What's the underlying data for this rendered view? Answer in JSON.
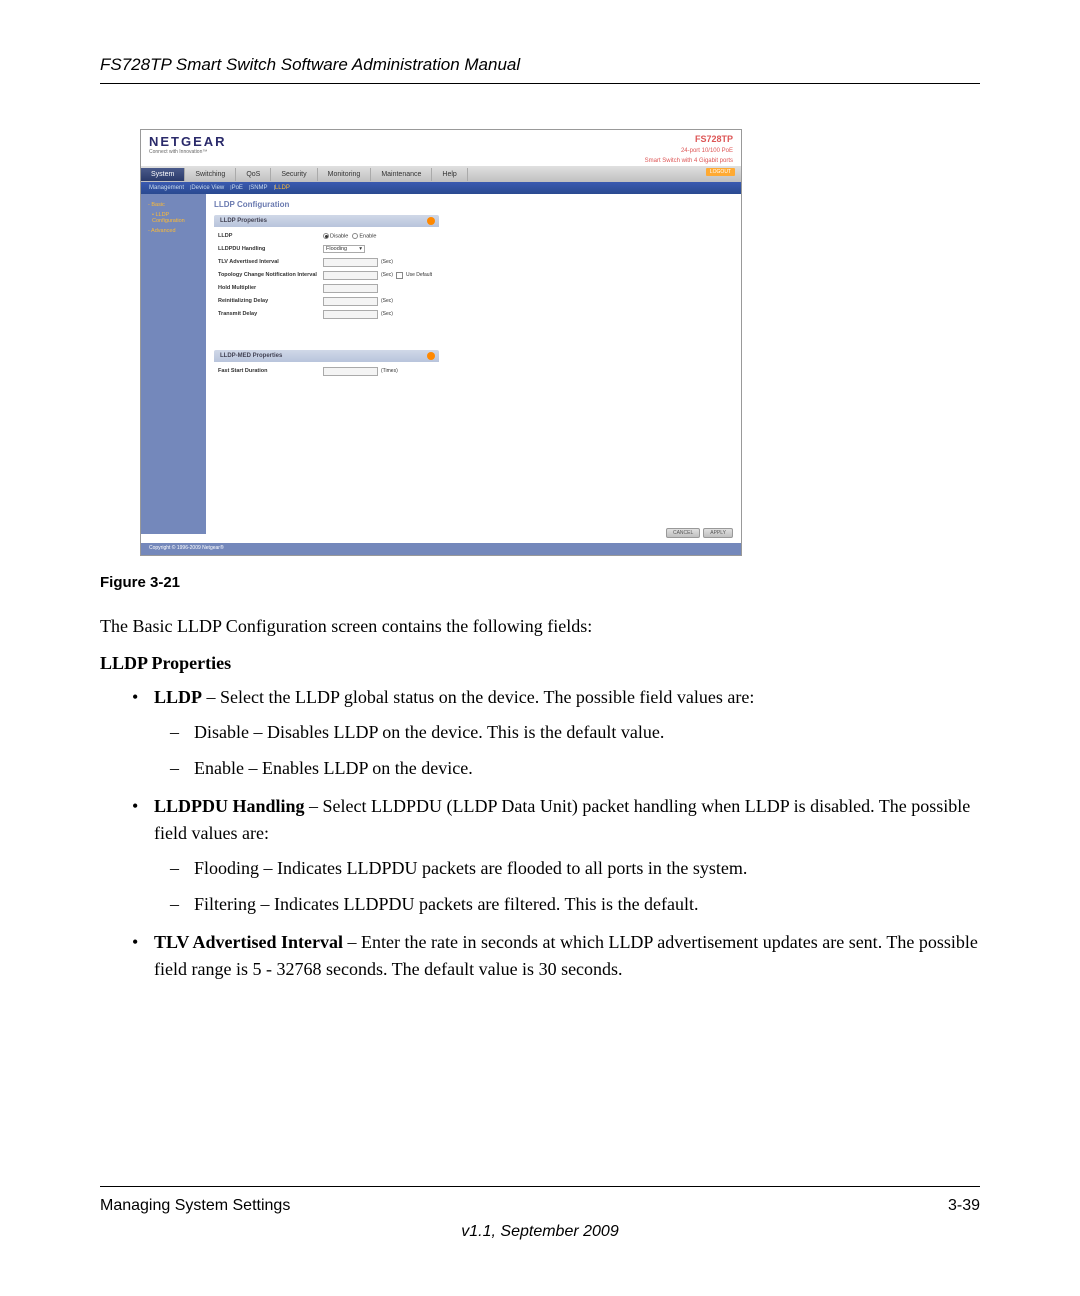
{
  "header": {
    "title": "FS728TP Smart Switch Software Administration Manual"
  },
  "screenshot": {
    "logo": "NETGEAR",
    "tagline": "Connect with Innovation™",
    "model": "FS728TP",
    "model_sub1": "24-port 10/100 PoE",
    "model_sub2": "Smart Switch with 4 Gigabit ports",
    "logout": "LOGOUT",
    "tabs": {
      "system": "System",
      "switching": "Switching",
      "qos": "QoS",
      "security": "Security",
      "monitoring": "Monitoring",
      "maintenance": "Maintenance",
      "help": "Help"
    },
    "subtabs": {
      "management": "Management",
      "device_view": "Device View",
      "poe": "PoE",
      "snmp": "SNMP",
      "lldp": "LLDP"
    },
    "sidebar": {
      "basic": "- Basic",
      "lldp_config": "• LLDP Configuration",
      "advanced": "- Advanced"
    },
    "page_title": "LLDP Configuration",
    "panel1": {
      "title": "LLDP Properties",
      "lldp_label": "LLDP",
      "disable": "Disable",
      "enable": "Enable",
      "handling_label": "LLDPDU Handling",
      "handling_value": "Flooding",
      "tlv_label": "TLV Advertised Interval",
      "tlv_unit": "(Sec)",
      "topology_label": "Topology Change Notification Interval",
      "topology_unit": "(Sec)",
      "use_default": "Use Default",
      "hold_label": "Hold Multiplier",
      "reinit_label": "Reinitializing Delay",
      "reinit_unit": "(Sec)",
      "transmit_label": "Transmit Delay",
      "transmit_unit": "(Sec)"
    },
    "panel2": {
      "title": "LLDP-MED Properties",
      "fast_label": "Fast Start Duration",
      "fast_unit": "(Times)"
    },
    "buttons": {
      "cancel": "CANCEL",
      "apply": "APPLY"
    },
    "copyright": "Copyright © 1996-2009 Netgear®"
  },
  "figure_caption": "Figure 3-21",
  "intro_text": "The Basic LLDP Configuration screen contains the following fields:",
  "section_title": "LLDP Properties",
  "bullets": {
    "b1_term": "LLDP",
    "b1_text": " – Select the LLDP global status on the device. The possible field values are:",
    "b1_s1": "Disable – Disables LLDP on the device. This is the default value.",
    "b1_s2": "Enable – Enables LLDP on the device.",
    "b2_term": "LLDPDU Handling",
    "b2_text": " – Select LLDPDU (LLDP Data Unit) packet handling when LLDP is disabled. The possible field values are:",
    "b2_s1": "Flooding – Indicates LLDPDU packets are flooded to all ports in the system.",
    "b2_s2": "Filtering – Indicates LLDPDU packets are filtered. This is the default.",
    "b3_term": "TLV Advertised Interval",
    "b3_text": " – Enter the rate in seconds at which LLDP advertisement updates are sent. The possible field range is 5 - 32768 seconds. The default value is 30 seconds."
  },
  "footer": {
    "section": "Managing System Settings",
    "page": "3-39",
    "version": "v1.1, September 2009"
  }
}
